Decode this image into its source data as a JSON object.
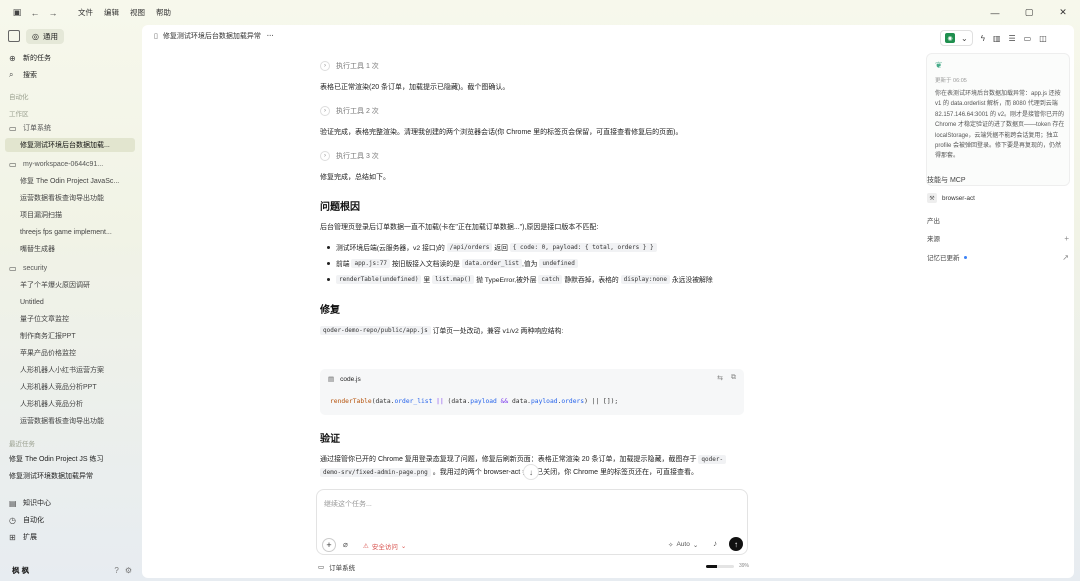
{
  "titlebar": {
    "menu": [
      "文件",
      "编辑",
      "视图",
      "帮助"
    ]
  },
  "sidebar": {
    "mode_label": "通用",
    "new_task": "新的任务",
    "search": "搜索",
    "automation_label": "自动化",
    "workspace_label": "工作区",
    "project_order": "订单系统",
    "project_order_tasks": [
      "修复测试环境后台数据加载..."
    ],
    "project_workspace": "my-workspace-0644c91...",
    "project_workspace_tasks": [
      "修复 The Odin Project JavaSc...",
      "运营数据看板查询导出功能",
      "项目漏洞扫描",
      "threejs fps game implement...",
      "嘴替生成器"
    ],
    "project_security": "security",
    "project_security_tasks": [
      "羊了个羊爆火原因调研",
      "Untitled",
      "量子位文章监控",
      "制作商务汇报PPT",
      "苹果产品价格监控",
      "人形机器人小红书运营方案",
      "人形机器人竞品分析PPT",
      "人形机器人竞品分析",
      "运营数据看板查询导出功能"
    ],
    "recent_label": "最近任务",
    "recent_tasks": [
      "修复 The Odin Project JS 练习",
      "修复测试环境数据加载异常"
    ],
    "knowledge": "知识中心",
    "automation": "自动化",
    "extensions": "扩展",
    "user_name": "枫 枫"
  },
  "main": {
    "doc_title": "修复测试环境后台数据加载异常",
    "tool_call_1": "执行工具 1 次",
    "para_1": "表格已正常渲染(20 条订单，加载提示已隐藏)。截个图确认。",
    "tool_call_2": "执行工具 2 次",
    "para_2": "验证完成，表格完整渲染。清理我创建的两个浏览器会话(你 Chrome 里的标签页会保留，可直接查看修复后的页面)。",
    "tool_call_3": "执行工具 3 次",
    "para_3": "修复完成，总结如下。",
    "h_root_cause": "问题根因",
    "root_cause_intro": "后台管理页登录后订单数据一直不加载(卡在\"正在加载订单数据...\"),原因是接口版本不匹配:",
    "b1_a": "测试环境后端(云服务器，v2 接口)的",
    "b1_code1": "/api/orders",
    "b1_b": "返回",
    "b1_code2": "{ code: 0, payload: { total, orders } }",
    "b2_a": "前端",
    "b2_code1": "app.js:77",
    "b2_b": "按旧版接入文档读的是",
    "b2_code2": "data.order_list",
    "b2_c": ",值为",
    "b2_code3": "undefined",
    "b3_code1": "renderTable(undefined)",
    "b3_a": "里",
    "b3_code2": "list.map()",
    "b3_b": "抛 TypeError,被外层",
    "b3_code3": "catch",
    "b3_c": "静默吞掉，表格的",
    "b3_code4": "display:none",
    "b3_d": "永远没被解除",
    "h_fix": "修复",
    "fix_code_path": "qoder-demo-repo/public/app.js",
    "fix_text": "订单页一处改动，兼容 v1/v2 两种响应结构:",
    "code_filename": "code.js",
    "code_fn": "renderTable",
    "code_p1": "(data.",
    "code_prop1": "order_list",
    "code_op1": " || ",
    "code_p2": "(data.",
    "code_prop2": "payload",
    "code_op2": " && ",
    "code_p3": "data.",
    "code_prop3": "payload",
    "code_p4": ".",
    "code_prop4": "orders",
    "code_p5": ") || []);",
    "h_verify": "验证",
    "verify_a": "通过接管你已开的 Chrome 复用登录态复现了问题，修复后刷新页面：表格正常渲染 20 条订单，加载提示隐藏，截图存于",
    "verify_code1": "qoder-",
    "verify_code2": "demo-srv/fixed-admin-page.png",
    "verify_b": "。我用过的两个 browser-act 会话已关闭，你 Chrome 里的标签页还在，可直接查看。"
  },
  "composer": {
    "placeholder": "继续这个任务...",
    "safety_label": "安全访问",
    "model_mode": "Auto"
  },
  "footer": {
    "project": "订单系统",
    "progress_label": "39%",
    "progress": 0.39
  },
  "right_panel": {
    "updated_prefix": "更新于",
    "updated_time": "06:05",
    "summary": "你在表测试环境后台数据加载异常：app.js 还按 v1 的 data.orderlist 解析，而 8080 代理到云端 82.157.146.64:3001 的 v2。刚才是接管你已开的 Chrome 才稳定验证的进了数据页——token 存在 localStorage，云端凭据不能跨会话复用；独立 profile 会被弹回登录。修下要是再复现的，仍然得那套。",
    "skills_title": "技能与 MCP",
    "skill_1": "browser-act",
    "output_title": "产出",
    "source_title": "来源",
    "memory_title": "记忆已更新"
  }
}
